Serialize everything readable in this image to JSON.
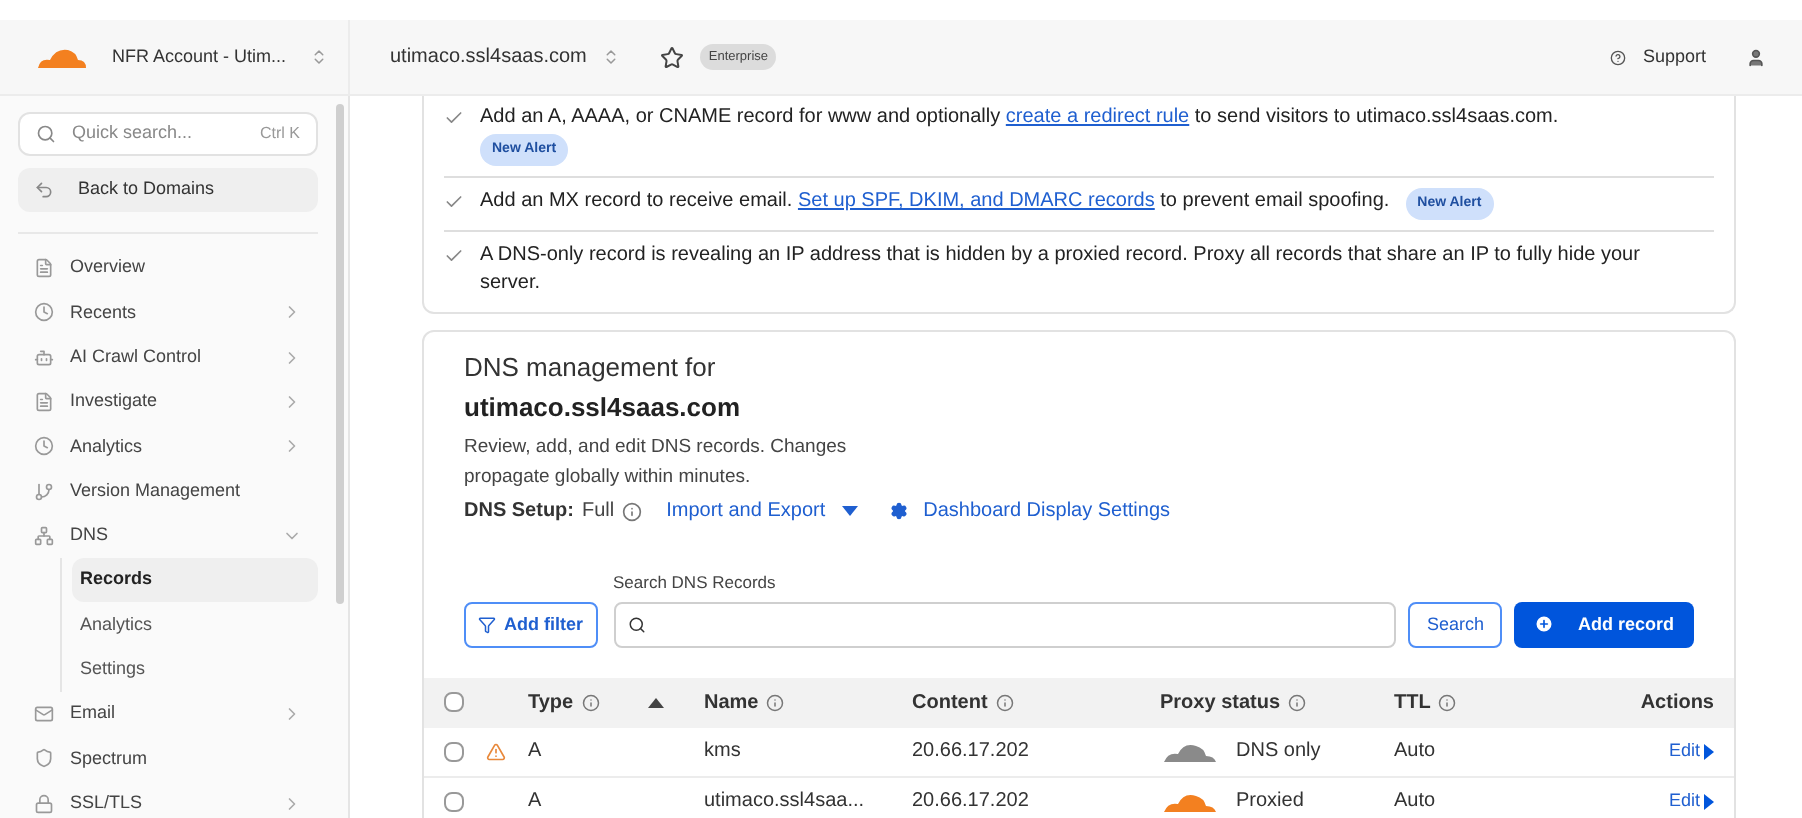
{
  "topbar": {
    "account": "NFR Account - Utim...",
    "domain": "utimaco.ssl4saas.com",
    "starred": false,
    "plan_badge": "Enterprise",
    "support": "Support"
  },
  "sidebar": {
    "search": {
      "placeholder": "Quick search...",
      "shortcut": "Ctrl K"
    },
    "back": "Back to Domains",
    "items": [
      {
        "label": "Overview",
        "has_arrow": false
      },
      {
        "label": "Recents",
        "has_arrow": true
      },
      {
        "label": "AI Crawl Control",
        "has_arrow": true
      },
      {
        "label": "Investigate",
        "has_arrow": true
      },
      {
        "label": "Analytics",
        "has_arrow": true
      },
      {
        "label": "Version Management",
        "has_arrow": false
      },
      {
        "label": "DNS",
        "has_arrow": true,
        "expanded": true,
        "children": [
          {
            "label": "Records",
            "selected": true
          },
          {
            "label": "Analytics",
            "selected": false
          },
          {
            "label": "Settings",
            "selected": false
          }
        ]
      },
      {
        "label": "Email",
        "has_arrow": true
      },
      {
        "label": "Spectrum",
        "has_arrow": false
      },
      {
        "label": "SSL/TLS",
        "has_arrow": true
      }
    ]
  },
  "alerts": [
    {
      "text": "Add an A, AAAA, or CNAME record for www and optionally ",
      "link": "create a redirect rule",
      "after": " to send visitors to utimaco.ssl4saas.com.",
      "badge": "New Alert"
    },
    {
      "text": "Add an MX record to receive email. ",
      "link": "Set up SPF, DKIM, and DMARC records",
      "after": " to prevent email spoofing.",
      "badge": "New Alert"
    },
    {
      "text": "A DNS-only record is revealing an IP address that is hidden by a proxied record. Proxy all records that share an IP to fully hide your server."
    }
  ],
  "dns": {
    "title": "DNS management for",
    "domain": "utimaco.ssl4saas.com",
    "description": "Review, add, and edit DNS records. Changes propagate globally within minutes.",
    "setup_label": "DNS Setup:",
    "setup_value": "Full",
    "import_export": "Import and Export",
    "display_settings": "Dashboard Display Settings",
    "search_label": "Search DNS Records",
    "add_filter": "Add filter",
    "search_button": "Search",
    "add_record": "Add record",
    "select_all_checked": false,
    "columns": [
      "Type",
      "Name",
      "Content",
      "Proxy status",
      "TTL",
      "Actions"
    ],
    "rows": [
      {
        "warning": true,
        "type": "A",
        "name": "kms",
        "content": "20.66.17.202",
        "kind": "dns_only",
        "proxy_label": "DNS only",
        "ttl": "Auto",
        "action": "Edit",
        "checked": false
      },
      {
        "warning": false,
        "type": "A",
        "name": "utimaco.ssl4saa...",
        "content": "20.66.17.202",
        "kind": "proxied",
        "proxy_label": "Proxied",
        "ttl": "Auto",
        "action": "Edit",
        "checked": false
      }
    ]
  }
}
